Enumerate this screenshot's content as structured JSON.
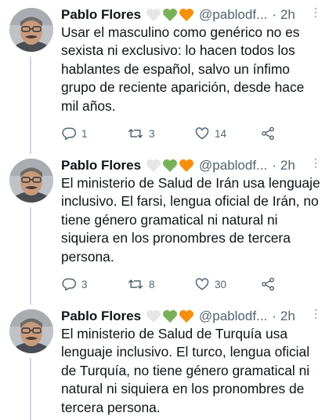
{
  "tweets": [
    {
      "author": "Pablo Flores",
      "handle": "@pablodf...",
      "dot": "·",
      "time": "2h",
      "text": "Usar el masculino como genérico no es sexista ni exclusivo: lo hacen todos los hablantes de español, salvo un ínfimo grupo de reciente aparición, desde hace mil años.",
      "replies": "1",
      "retweets": "3",
      "likes": "14"
    },
    {
      "author": "Pablo Flores",
      "handle": "@pablodf...",
      "dot": "·",
      "time": "2h",
      "text": "El ministerio de Salud de Irán usa lenguaje inclusivo. El farsi, lengua oficial de Irán, no tiene género gramatical ni natural ni siquiera en los pronombres de tercera persona.",
      "replies": "3",
      "retweets": "8",
      "likes": "30"
    },
    {
      "author": "Pablo Flores",
      "handle": "@pablodf...",
      "dot": "·",
      "time": "2h",
      "text": "El ministerio de Salud de Turquía usa lenguaje inclusivo. El turco, lengua oficial de Turquía, no tiene género gramatical ni natural ni siquiera en los pronombres de tercera persona."
    }
  ],
  "icons": {
    "heart_colors": [
      "#e8e8e8",
      "#78b159",
      "#f4900c"
    ],
    "reply": "reply-icon",
    "retweet": "retweet-icon",
    "like": "like-icon",
    "share": "share-icon",
    "more": "more-icon"
  }
}
